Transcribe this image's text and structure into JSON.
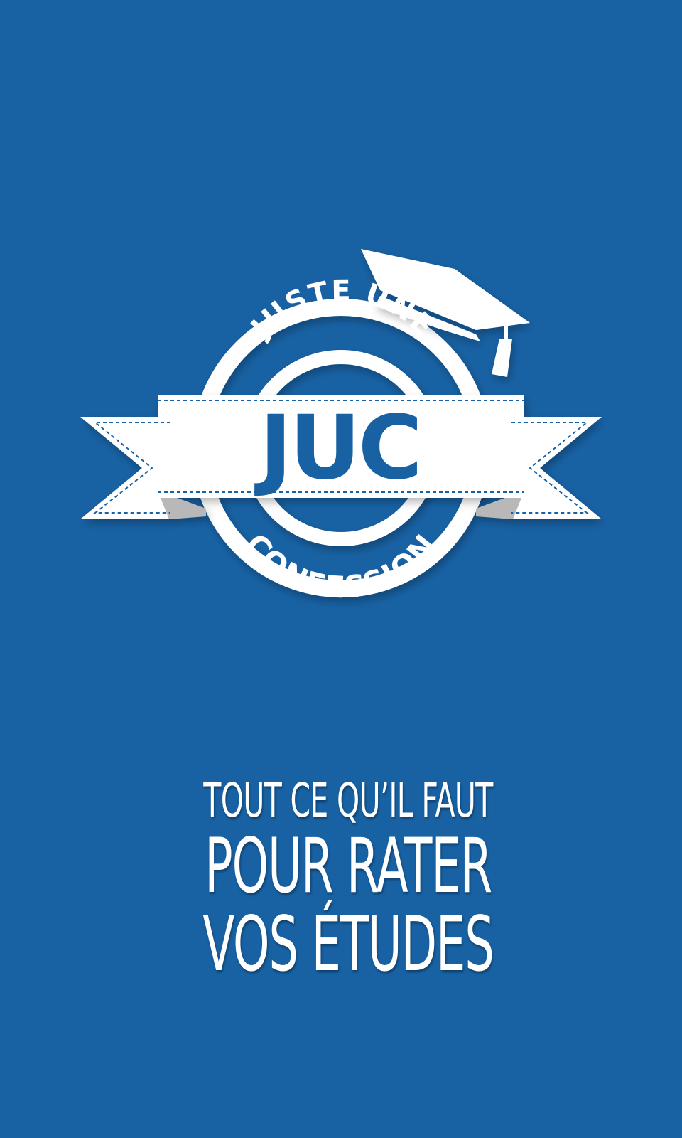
{
  "app": {
    "background_color": "#1862a4",
    "accent_color": "#ffffff"
  },
  "logo": {
    "arc_top_text": "JUSTE UNE",
    "main_text": "JUC",
    "arc_bottom_text": "CONFESSION",
    "icon": "graduation-cap-icon"
  },
  "tagline": {
    "line1": "TOUT CE QU’IL FAUT",
    "line2": "POUR RATER",
    "line3": "VOS ÉTUDES"
  }
}
